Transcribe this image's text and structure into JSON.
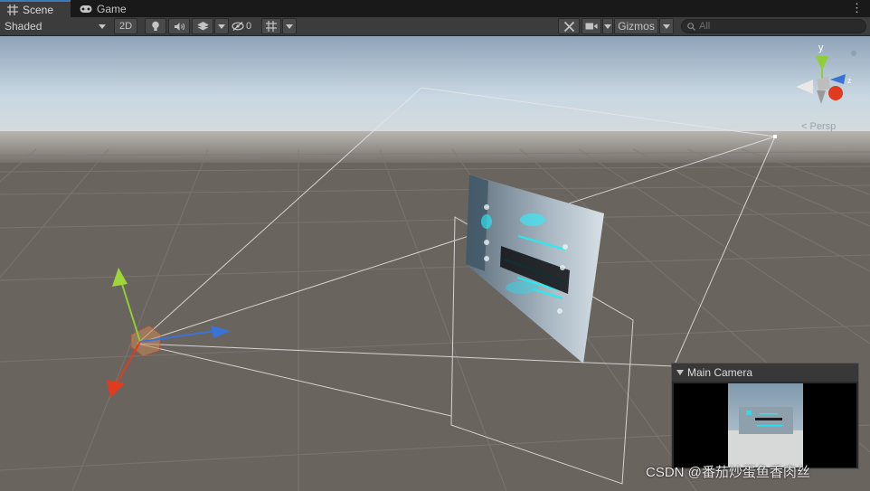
{
  "tabs": [
    {
      "label": "Scene",
      "icon": "grid-icon",
      "active": true
    },
    {
      "label": "Game",
      "icon": "gamepad-icon",
      "active": false
    }
  ],
  "toolbar": {
    "draw_mode": "Shaded",
    "mode_2d": "2D",
    "hidden_count": "0",
    "gizmos_label": "Gizmos",
    "search_placeholder": "All"
  },
  "scene": {
    "axis_gizmo": {
      "y_label": "y",
      "z_label": "z",
      "projection_label": "Persp"
    }
  },
  "camera_preview": {
    "title": "Main Camera"
  },
  "watermark": "CSDN @番茄炒蛋鱼香肉丝",
  "colors": {
    "tab_accent": "#3a79bb",
    "sky_top": "#8fa4b8",
    "ground": "#6a645f",
    "axis_x": "#e03b1f",
    "axis_y": "#8fce34",
    "axis_z": "#3a73d6"
  }
}
